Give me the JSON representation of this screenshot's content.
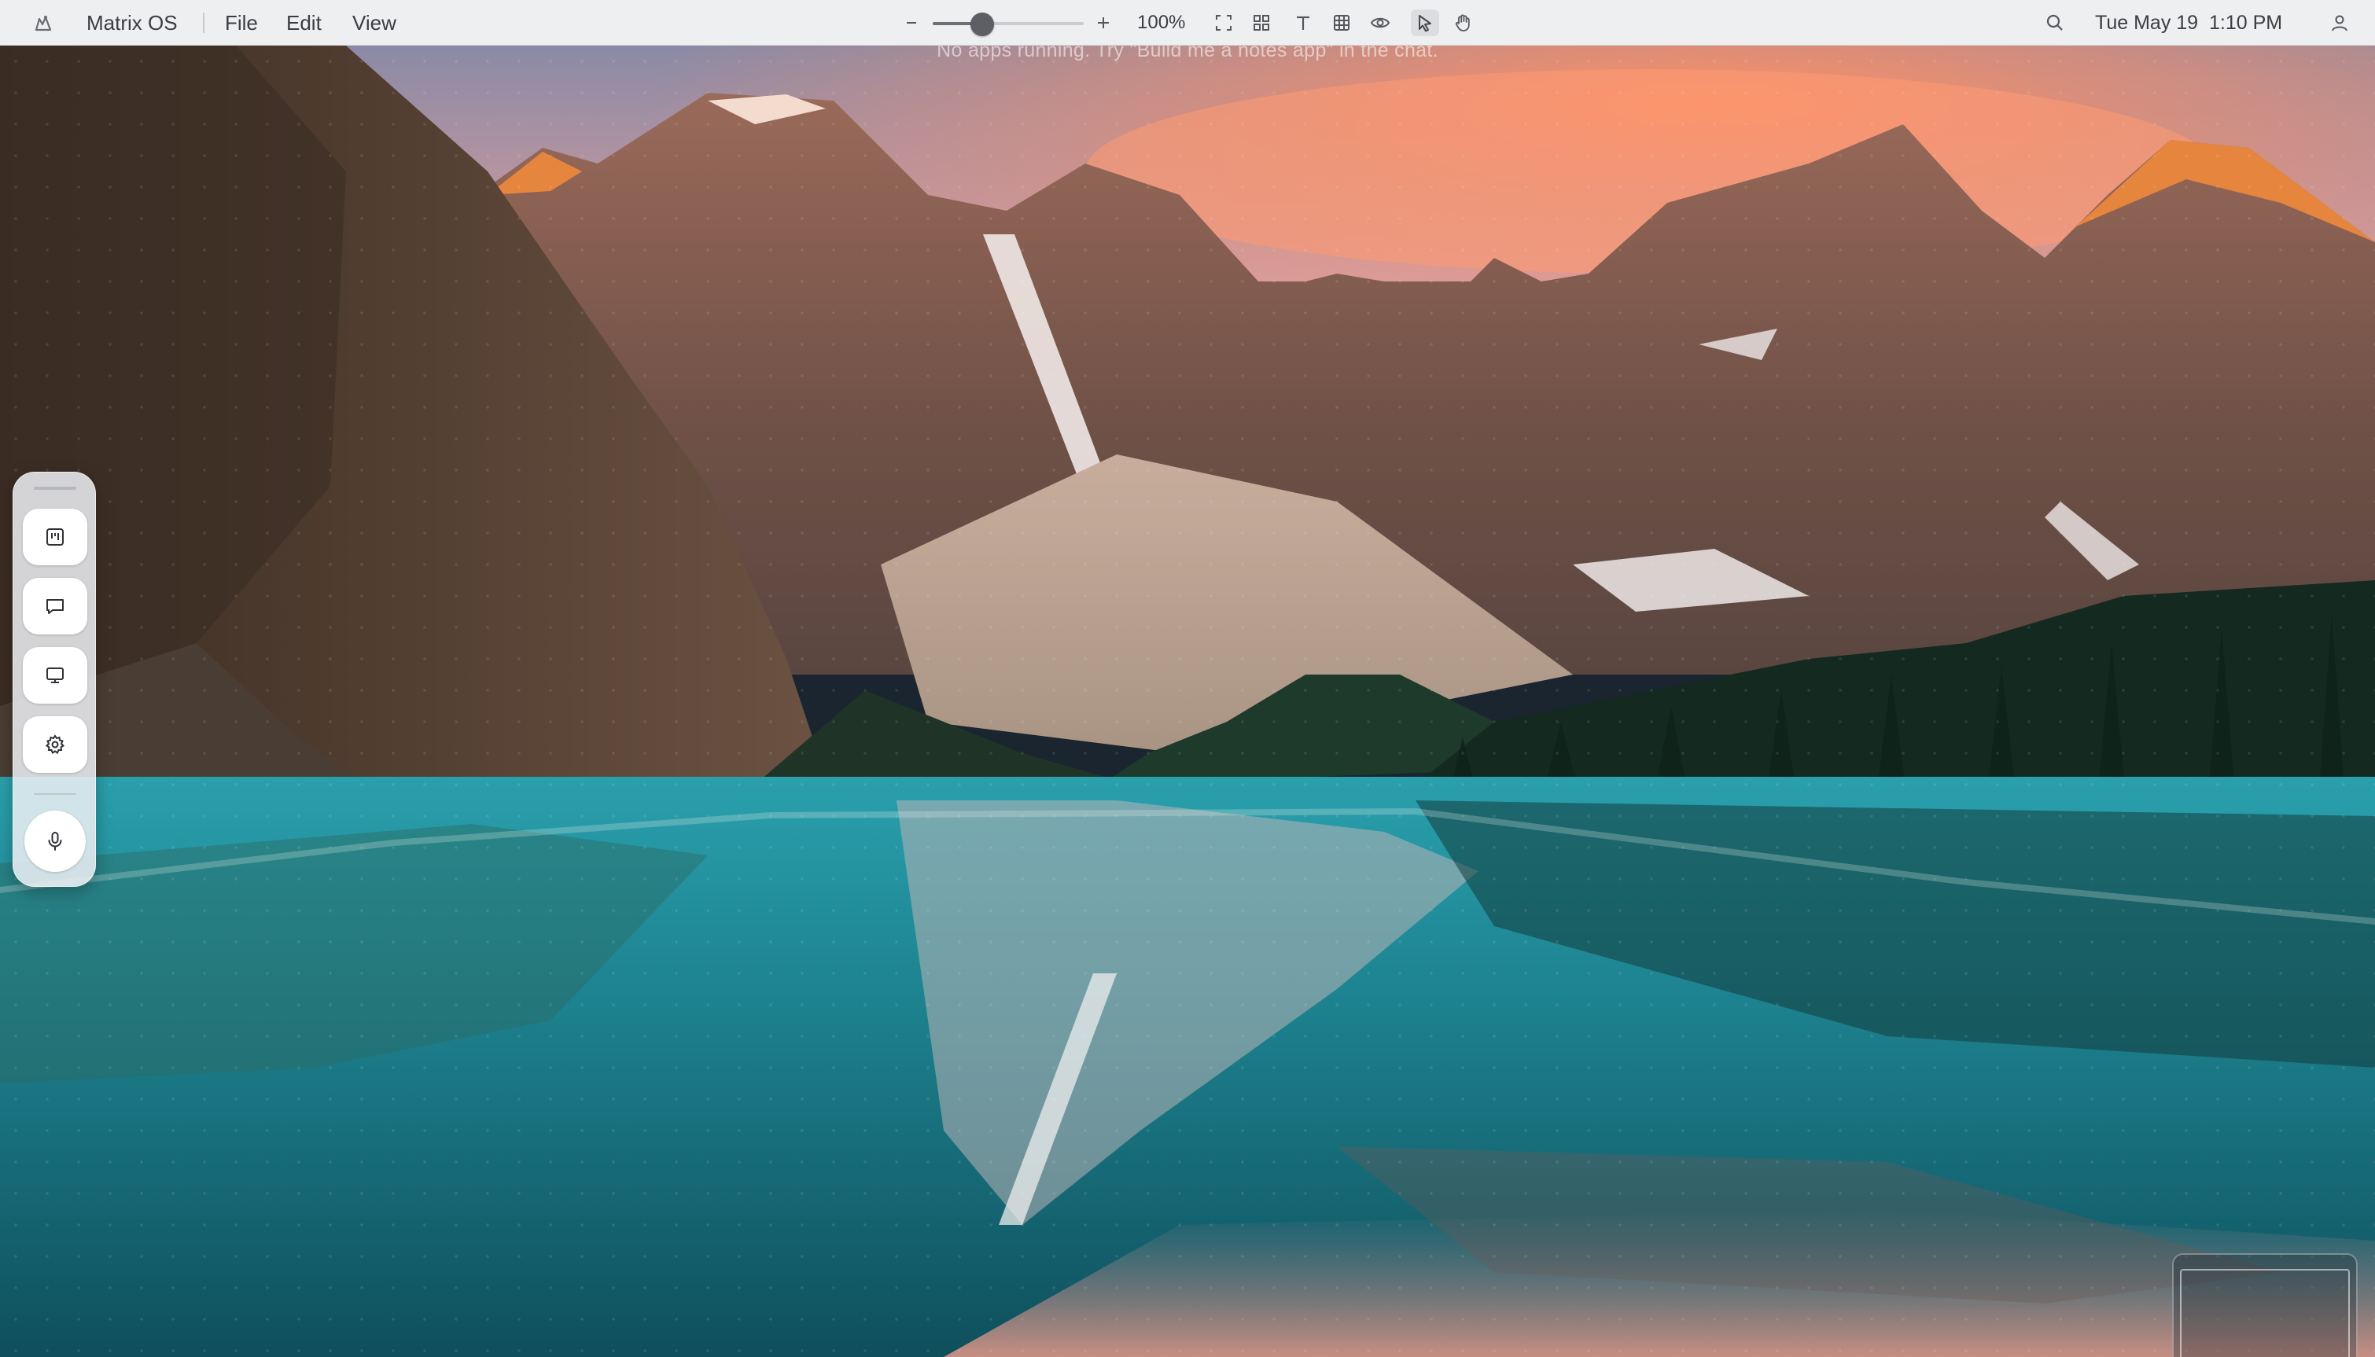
{
  "menubar": {
    "app_name": "Matrix OS",
    "menus": [
      "File",
      "Edit",
      "View"
    ],
    "zoom": {
      "label": "100%",
      "level_percent": 100,
      "slider_fraction": 0.33
    },
    "tools": [
      "fit-screen-icon",
      "grid-layout-icon",
      "text-tool-icon",
      "table-icon",
      "eye-icon",
      "pointer-tool-icon",
      "hand-tool-icon"
    ],
    "active_tool": "pointer-tool-icon",
    "datetime": "Tue May 19  1:10 PM"
  },
  "desktop": {
    "hint": "No apps running. Try \"Build me a notes app\" in the chat."
  },
  "dock": {
    "items": [
      "kanban-board-icon",
      "chat-bubble-icon",
      "monitor-icon",
      "gear-icon"
    ],
    "mic": "microphone-icon"
  },
  "colors": {
    "menubar_bg": "#eeeff1",
    "lake": "#1e7f8c",
    "sky_glow": "#f2906c",
    "forest": "#162a21"
  }
}
